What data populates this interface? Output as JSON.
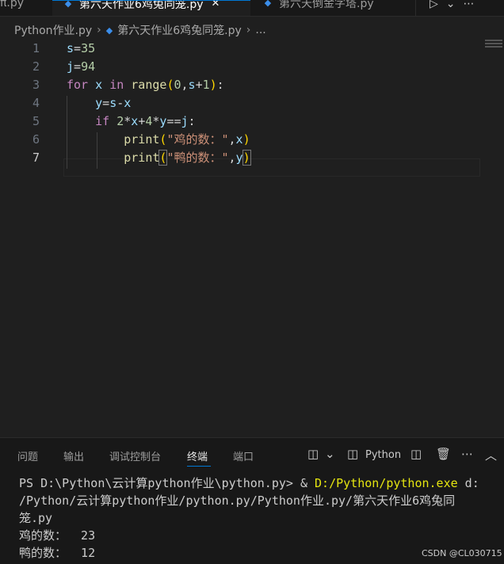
{
  "tabs": {
    "partial_label": "π.py",
    "active_label": "第六天作业6鸡兔同笼.py",
    "inactive_label": "第六天倒金字塔.py",
    "close_glyph": "✕"
  },
  "tab_actions": {
    "run_glyph": "▷",
    "chevron_glyph": "⌄",
    "more_glyph": "⋯"
  },
  "breadcrumb": {
    "folder": "Python作业.py",
    "file": "第六天作业6鸡兔同笼.py",
    "sep": "›",
    "ellipsis": "..."
  },
  "code": {
    "line_numbers": [
      "1",
      "2",
      "3",
      "4",
      "5",
      "6",
      "7"
    ],
    "l1": {
      "var": "s",
      "op": "=",
      "num": "35"
    },
    "l2": {
      "var": "j",
      "op": "=",
      "num": "94"
    },
    "l3": {
      "kw_for": "for",
      "var": "x",
      "kw_in": "in",
      "fn": "range",
      "open": "(",
      "n0": "0",
      "comma": ",",
      "s": "s",
      "plus": "+",
      "n1": "1",
      "close": ")",
      "colon": ":"
    },
    "l4": {
      "y": "y",
      "eq": "=",
      "s": "s",
      "minus": "-",
      "x": "x"
    },
    "l5": {
      "kw_if": "if",
      "n2": "2",
      "mul1": "*",
      "x": "x",
      "plus": "+",
      "n4": "4",
      "mul2": "*",
      "y": "y",
      "eqeq": "==",
      "j": "j",
      "colon": ":"
    },
    "l6": {
      "fn": "print",
      "open": "(",
      "str": "\"鸡的数：\"",
      "comma": ",",
      "arg": "x",
      "close": ")"
    },
    "l7": {
      "fn": "print",
      "open": "(",
      "str": "\"鸭的数：\"",
      "comma": ",",
      "arg": "y",
      "close": ")"
    }
  },
  "panel": {
    "tabs": [
      "问题",
      "输出",
      "调试控制台",
      "终端",
      "端口"
    ],
    "active_tab": "终端",
    "split_glyph": "◫",
    "chevron_glyph": "⌄",
    "terminal_icon_glyph": "◫",
    "profile_label": "Python",
    "layout_glyph": "◫",
    "trash_glyph": "🗑",
    "more_glyph": "⋯",
    "collapse_glyph": "︿"
  },
  "terminal": {
    "prompt": "PS D:\\Python\\云计算python作业\\python.py> & ",
    "exe": "D:/Python/python.exe",
    "arg_tail": " d:",
    "line2": "/Python/云计算python作业/python.py/Python作业.py/第六天作业6鸡兔同",
    "line3": "笼.py",
    "out1": "鸡的数：  23",
    "out2": "鸭的数：  12"
  },
  "watermark": "CSDN @CL030715",
  "colors": {
    "editor_bg": "#1f1f1f",
    "panel_bg": "#181818",
    "accent": "#0078d4",
    "keyword": "#c586c0",
    "function": "#dcdcaa",
    "number": "#b5cea8",
    "string": "#ce9178",
    "variable": "#9cdcfe"
  }
}
